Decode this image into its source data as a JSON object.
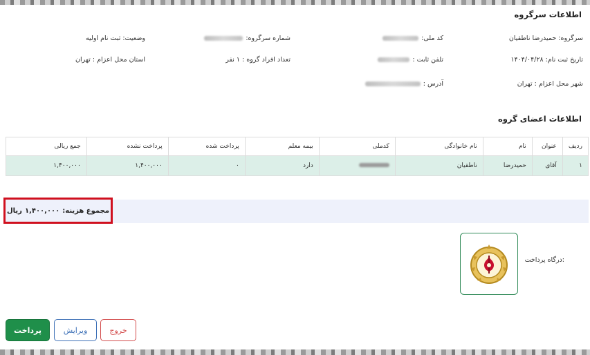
{
  "group_info": {
    "title": "اطلاعات سرگروه",
    "fields": [
      {
        "label": "سرگروه:",
        "value": "حمیدرضا ناطقیان"
      },
      {
        "label": "کد ملی:",
        "value": "•••••••۴",
        "masked": true
      },
      {
        "label": "شماره سرگروه:",
        "value": "••••••۷۴",
        "masked": true
      },
      {
        "label": "وضعیت:",
        "value": "ثبت نام اولیه"
      },
      {
        "label": "تاریخ ثبت نام:",
        "value": "۱۴۰۴/۰۴/۲۸"
      },
      {
        "label": "تلفن ثابت :",
        "value": "•••••۰۳",
        "masked": true
      },
      {
        "label": "تعداد افراد گروه :",
        "value": "۱ نفر"
      },
      {
        "label": "استان محل اعزام :",
        "value": "تهران"
      },
      {
        "label": "شهر محل اعزام :",
        "value": "تهران"
      },
      {
        "label": "آدرس :",
        "value": "خیابان ••••• کوچه •••",
        "masked": true
      }
    ]
  },
  "members": {
    "title": "اطلاعات اعضای گروه",
    "columns": [
      "ردیف",
      "عنوان",
      "نام",
      "نام خانوادگی",
      "کدملی",
      "بیمه معلم",
      "پرداخت شده",
      "پرداخت نشده",
      "جمع ریالی"
    ],
    "rows": [
      [
        "۱",
        "آقای",
        "حمیدرضا",
        "ناطقیان",
        "•••••••۴",
        "دارد",
        "۰",
        "۱,۴۰۰,۰۰۰",
        "۱,۴۰۰,۰۰۰"
      ]
    ]
  },
  "summary": {
    "label": "مجموع هزینه:",
    "amount": "۱,۴۰۰,۰۰۰",
    "unit": "ریال"
  },
  "gateway": {
    "label": "درگاه پرداخت:",
    "bank_icon": "bank-melli-emblem-icon"
  },
  "buttons": {
    "pay": "پرداخت",
    "edit": "ویرایش",
    "exit": "خروج"
  },
  "colors": {
    "pay_button": "#1f8f4a",
    "edit_button": "#3b6fb6",
    "exit_button": "#d24a4a",
    "highlight_box": "#d0101f",
    "table_row": "#dcefe8",
    "summary_bar": "#eef1fb"
  }
}
